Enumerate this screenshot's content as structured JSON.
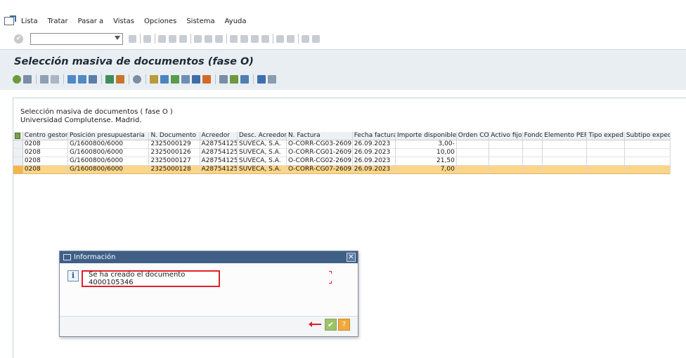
{
  "menu": {
    "items": [
      {
        "label": "Lista"
      },
      {
        "label": "Tratar"
      },
      {
        "label": "Pasar a"
      },
      {
        "label": "Vistas"
      },
      {
        "label": "Opciones"
      },
      {
        "label": "Sistema"
      },
      {
        "label": "Ayuda"
      }
    ]
  },
  "command_field": {
    "value": ""
  },
  "page": {
    "title": "Selección masiva de documentos (fase O)",
    "header_line1": "Selección masiva de documentos ( fase O )",
    "header_line2": "Universidad Complutense. Madrid."
  },
  "grid": {
    "columns": [
      {
        "label": "Centro gestor"
      },
      {
        "label": "Posición presupuestaria"
      },
      {
        "label": "N. Documento"
      },
      {
        "label": "Acreedor"
      },
      {
        "label": "Desc. Acreedor"
      },
      {
        "label": "N. Factura"
      },
      {
        "label": "Fecha factura"
      },
      {
        "label": "Importe disponible"
      },
      {
        "label": "Orden CO"
      },
      {
        "label": "Activo fijo"
      },
      {
        "label": "Fondo"
      },
      {
        "label": "Elemento PEP"
      },
      {
        "label": "Tipo exped."
      },
      {
        "label": "Subtipo exped."
      }
    ],
    "rows": [
      {
        "cells": [
          "0208",
          "G/1600800/6000",
          "2325000129",
          "A28754125",
          "SUVECA, S.A.",
          "O-CORR-CG03-2609",
          "26.09.2023",
          "3,00-",
          "",
          "",
          "",
          "",
          "",
          ""
        ]
      },
      {
        "cells": [
          "0208",
          "G/1600800/6000",
          "2325000126",
          "A28754125",
          "SUVECA, S.A.",
          "O-CORR-CG01-2609",
          "26.09.2023",
          "10,00",
          "",
          "",
          "",
          "",
          "",
          ""
        ]
      },
      {
        "cells": [
          "0208",
          "G/1600800/6000",
          "2325000127",
          "A28754125",
          "SUVECA, S.A.",
          "O-CORR-CG02-2609",
          "26.09.2023",
          "21,50",
          "",
          "",
          "",
          "",
          "",
          ""
        ]
      },
      {
        "cells": [
          "0208",
          "G/1600800/6000",
          "2325000128",
          "A28754125",
          "SUVECA, S.A.",
          "O-CORR-CG07-2609",
          "26.09.2023",
          "7,00",
          "",
          "",
          "",
          "",
          "",
          ""
        ]
      }
    ],
    "selected_row": 3
  },
  "dialog": {
    "title": "Información",
    "message": "Se ha creado el documento 4000105346",
    "close_symbol": "✕",
    "ok_symbol": "✔",
    "help_symbol": "?"
  },
  "colors": {
    "title_bg": "#e9eef3",
    "dialog_title_bg": "#3f5f86",
    "selected_row": "#fbd58a",
    "highlight": "#e0202a"
  }
}
